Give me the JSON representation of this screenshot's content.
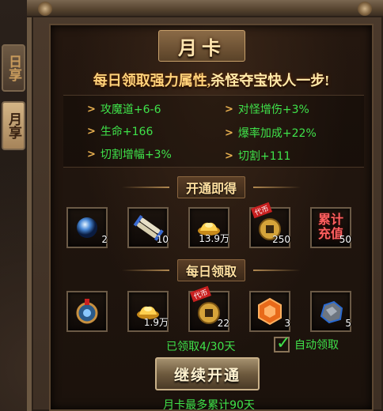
{
  "tabs": [
    {
      "label": "日享",
      "active": false
    },
    {
      "label": "月享",
      "active": true
    }
  ],
  "title": "月卡",
  "slogan": {
    "part1": "每日领取强力属性,",
    "part2": "杀怪夺宝快人一步!"
  },
  "attributes": [
    "攻魔道+6-6",
    "对怪增伤+3%",
    "生命+166",
    "爆率加成+22%",
    "切割增幅+3%",
    "切割+111"
  ],
  "section_unlock": "开通即得",
  "unlock_items": [
    {
      "icon": "blue-orb-icon",
      "count": "2"
    },
    {
      "icon": "scroll-bundle-icon",
      "count": "10"
    },
    {
      "icon": "gold-ingot-icon",
      "count": "13.9万"
    },
    {
      "icon": "copper-coin-icon",
      "count": "250",
      "badge": "代币"
    },
    {
      "icon": "cumulative-recharge-icon",
      "count": "50",
      "text": "累计充值"
    }
  ],
  "section_daily": "每日领取",
  "daily_items": [
    {
      "icon": "amulet-icon",
      "count": ""
    },
    {
      "icon": "gold-ingot-icon",
      "count": "1.9万"
    },
    {
      "icon": "copper-coin-icon",
      "count": "22",
      "badge": "代币"
    },
    {
      "icon": "orange-hex-gem-icon",
      "count": "3"
    },
    {
      "icon": "ore-stone-icon",
      "count": "5"
    }
  ],
  "claim_status": "已领取4/30天",
  "auto_claim_label": "自动领取",
  "auto_claim_checked": true,
  "continue_button": "继续开通",
  "footer_note": "月卡最多累计90天",
  "colors": {
    "accent_green": "#3fe24a",
    "gold": "#ffd27a"
  }
}
